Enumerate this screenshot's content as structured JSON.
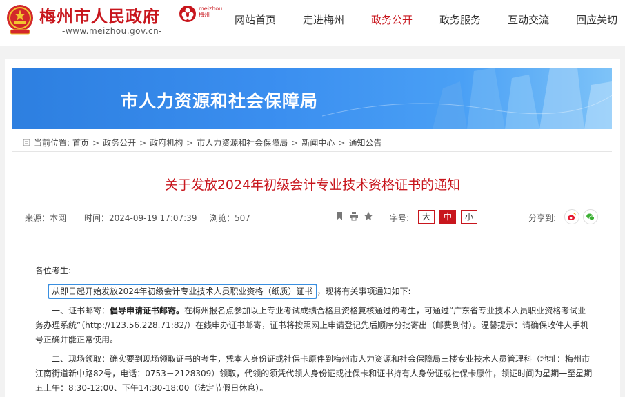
{
  "header": {
    "site_title": "梅州市人民政府",
    "site_url": "-www.meizhou.gov.cn-",
    "brand_text_line1": "meizhou",
    "brand_text_line2": "梅州",
    "nav": [
      {
        "label": "网站首页",
        "active": false
      },
      {
        "label": "走进梅州",
        "active": false
      },
      {
        "label": "政务公开",
        "active": true
      },
      {
        "label": "政务服务",
        "active": false
      },
      {
        "label": "互动交流",
        "active": false
      },
      {
        "label": "回应关切",
        "active": false
      }
    ],
    "accent_color": "#c8161d"
  },
  "banner": {
    "title": "市人力资源和社会保障局",
    "color": "#3b8ff0"
  },
  "breadcrumb": {
    "label": "当前位置:",
    "items": [
      "首页",
      "政务公开",
      "政府机构",
      "市人力资源和社会保障局",
      "新闻中心",
      "通知公告"
    ],
    "separator": ">"
  },
  "article": {
    "title": "关于发放2024年初级会计专业技术资格证书的通知",
    "meta": {
      "source": "来源：本网",
      "time": "时间：2024-09-19 17:07:39",
      "views": "浏览：507",
      "font_label": "字号:",
      "font_sizes": [
        "大",
        "中",
        "小"
      ],
      "font_active": "中",
      "share_label": "分享到:",
      "share_icons": [
        "weibo-icon",
        "wechat-icon"
      ]
    },
    "greeting": "各位考生:",
    "first_highlight": "从即日起开始发放2024年初级会计专业技术人员职业资格（纸质）证书",
    "first_rest": "，现将有关事项通知如下:",
    "p1_prefix": "一、证书邮寄：",
    "p1_bold": "倡导申请证书邮寄。",
    "p1_rest": "在梅州报名点参加以上专业考试成绩合格且资格复核通过的考生，可通过“广东省专业技术人员职业资格考试业务办理系统”（http://123.56.228.71:82/）在线申办证书邮寄，证书将按照网上申请登记先后顺序分批寄出（邮费到付）。温馨提示：请确保收件人手机号正确并能正常使用。",
    "p2_text": "二、现场领取：确实要到现场领取证书的考生，凭本人身份证或社保卡原件到梅州市人力资源和社会保障局三楼专业技术人员管理科（地址：梅州市江南街道新中路82号，电话：0753－2128309）领取，代领的须凭代领人身份证或社保卡和证书持有人身份证或社保卡原件，领证时间为星期一至星期五上午：8:30-12:00、下午14:30-18:00（法定节假日休息）。"
  }
}
